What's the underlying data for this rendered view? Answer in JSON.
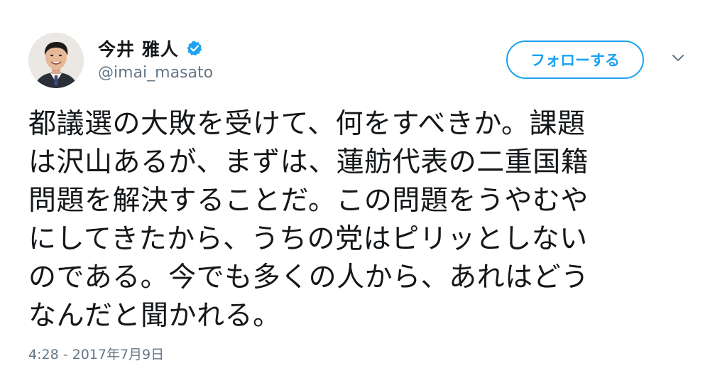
{
  "user": {
    "display_name": "今井 雅人",
    "handle": "@imai_masato",
    "verified": true,
    "verified_icon": "verified-badge-icon",
    "avatar_icon": "avatar-photo"
  },
  "actions": {
    "follow_label": "フォローする",
    "menu_icon": "chevron-down-icon"
  },
  "tweet": {
    "lines": [
      "都議選の大敗を受けて、何をすべきか。課題",
      "は沢山あるが、まずは、蓮舫代表の二重国籍",
      "問題を解決することだ。この問題をうやむや",
      "にしてきたから、うちの党はピリッとしない",
      "のである。今でも多くの人から、あれはどう",
      "なんだと聞かれる。"
    ],
    "timestamp": "4:28 - 2017年7月9日"
  },
  "colors": {
    "accent": "#1da1f2",
    "text": "#14171a",
    "secondary": "#657786"
  }
}
